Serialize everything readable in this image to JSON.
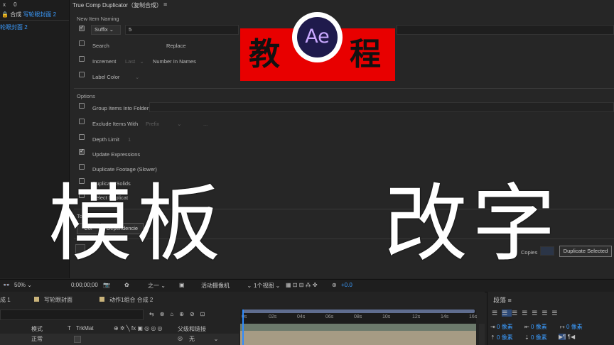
{
  "left_panel": {
    "row1_icon": "x",
    "row1_num": "0",
    "row2_prefix": "合成",
    "row2_name": "写轮眼封面 2",
    "row3_name": "轮眼封面 2"
  },
  "panel": {
    "title": "True Comp Duplicator（复制合成）",
    "menu": "≡",
    "new_item_naming": "New Item Naming",
    "suffix_label": "Suffix",
    "suffix_value": "5",
    "search": "Search",
    "replace": "Replace",
    "increment": "Increment",
    "increment_mode": "Last",
    "number_in_names": "Number In Names",
    "label_color": "Label Color",
    "options": "Options",
    "group_items": "Group Items Into Folder",
    "exclude_items": "Exclude Items With",
    "exclude_mode": "Prefix",
    "depth_limit": "Depth Limit",
    "depth_value": "1",
    "update_expressions": "Update Expressions",
    "duplicate_footage": "Duplicate Footage (Slower)",
    "duplicate_solids": "Duplicate Solids",
    "select_duplicates": "Select Duplicat",
    "tools": "Tools",
    "collapse_btn": "Col",
    "dependencies_btn": "Dependencie",
    "copies_label": "Copies",
    "duplicate_selected": "Duplicate Selected"
  },
  "logo": {
    "left_char": "教",
    "right_char": "程",
    "ae_text": "Ae"
  },
  "overlay": {
    "text1": "模板",
    "text2": "改字"
  },
  "viewer_bar": {
    "zoom": "50%",
    "timecode": "0;00;00;00",
    "resolution": "之一",
    "camera": "活动摄像机",
    "views": "1个视图",
    "exposure": "+0.0"
  },
  "timeline": {
    "tab1": "成 1",
    "tab2": "写轮眼封面",
    "tab3": "动作1组合 合成 2",
    "col_mode": "模式",
    "col_t": "T",
    "col_trkmat": "TrkMat",
    "col_parent": "父级和链接",
    "row_mode": "正常",
    "row_parent": "无",
    "ticks": [
      "0s",
      "02s",
      "04s",
      "06s",
      "08s",
      "10s",
      "12s",
      "14s",
      "16s"
    ]
  },
  "paragraph_panel": {
    "title": "段落",
    "menu": "≡",
    "px1": "0 像素",
    "px2": "0 像素",
    "px3": "0 像素",
    "px4": "0 像素",
    "px5": "0 像素"
  }
}
